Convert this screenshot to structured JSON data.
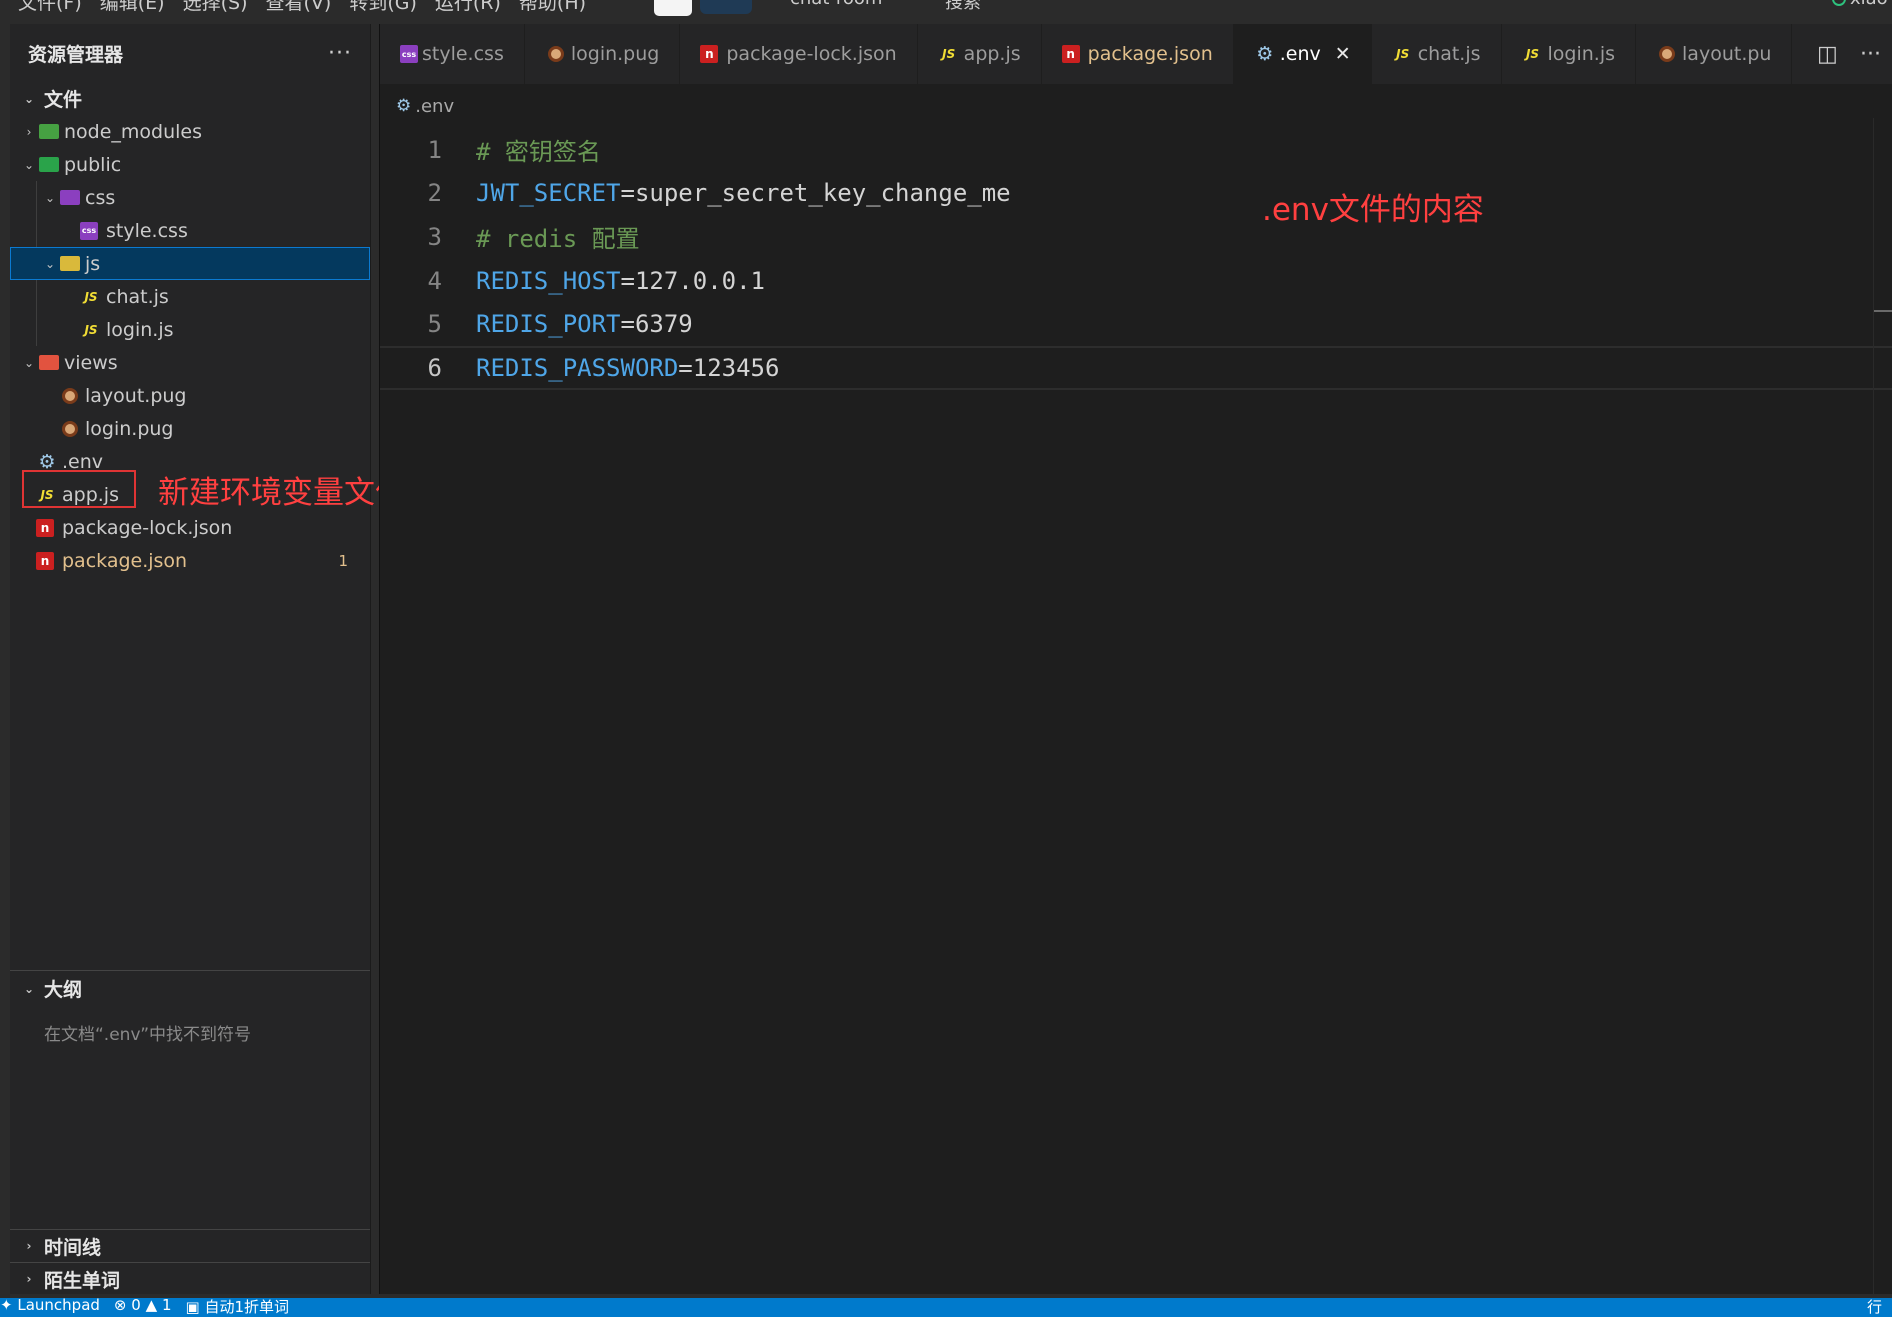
{
  "titlebar": {
    "menus": [
      "文件(F)",
      "编辑(E)",
      "选择(S)",
      "查看(V)",
      "转到(G)",
      "运行(R)",
      "帮助(H)"
    ],
    "search_text": "chat-room",
    "search_label": "搜索",
    "account": "xiao"
  },
  "explorer": {
    "title": "资源管理器",
    "more": "···",
    "root_section": "文件",
    "items": [
      {
        "label": "node_modules",
        "icon": "folder-node-icon"
      },
      {
        "label": "public",
        "icon": "folder-public-icon"
      },
      {
        "label": "css",
        "icon": "folder-css-icon"
      },
      {
        "label": "style.css",
        "icon": "css-file-icon"
      },
      {
        "label": "js",
        "icon": "folder-js-icon"
      },
      {
        "label": "chat.js",
        "icon": "js-file-icon"
      },
      {
        "label": "login.js",
        "icon": "js-file-icon"
      },
      {
        "label": "views",
        "icon": "folder-views-icon"
      },
      {
        "label": "layout.pug",
        "icon": "pug-file-icon"
      },
      {
        "label": "login.pug",
        "icon": "pug-file-icon"
      },
      {
        "label": ".env",
        "icon": "gear-icon"
      },
      {
        "label": "app.js",
        "icon": "js-file-icon"
      },
      {
        "label": "package-lock.json",
        "icon": "npm-file-icon"
      },
      {
        "label": "package.json",
        "icon": "npm-file-icon",
        "badge": "1"
      }
    ],
    "annotation_new_file": "新建环境变量文件"
  },
  "outline": {
    "title": "大纲",
    "empty_message": "在文档“.env”中找不到符号"
  },
  "timeline": {
    "title": "时间线"
  },
  "vocab": {
    "title": "陌生单词"
  },
  "editor": {
    "tabs": [
      {
        "label": "style.css",
        "icon": "css-file-icon"
      },
      {
        "label": "login.pug",
        "icon": "pug-file-icon"
      },
      {
        "label": "package-lock.json",
        "icon": "npm-file-icon"
      },
      {
        "label": "app.js",
        "icon": "js-file-icon"
      },
      {
        "label": "package.json",
        "icon": "npm-file-icon"
      },
      {
        "label": ".env",
        "icon": "gear-icon",
        "active": true
      },
      {
        "label": "chat.js",
        "icon": "js-file-icon"
      },
      {
        "label": "login.js",
        "icon": "js-file-icon"
      },
      {
        "label": "layout.pu",
        "icon": "pug-file-icon"
      }
    ],
    "breadcrumb": ".env",
    "lines": [
      {
        "num": "1",
        "comment": "# 密钥签名"
      },
      {
        "num": "2",
        "key": "JWT_SECRET",
        "value": "=super_secret_key_change_me"
      },
      {
        "num": "3",
        "comment": "# redis 配置"
      },
      {
        "num": "4",
        "key": "REDIS_HOST",
        "value": "=127.0.0.1"
      },
      {
        "num": "5",
        "key": "REDIS_PORT",
        "value": "=6379"
      },
      {
        "num": "6",
        "key": "REDIS_PASSWORD",
        "value": "=123456"
      }
    ],
    "annotation_content": ".env文件的内容"
  },
  "statusbar": {
    "launchpad": "Launchpad",
    "errors": "0",
    "warnings": "1",
    "auto_translate": "自动1折单词",
    "position": "行"
  },
  "colors": {
    "accent": "#007acc",
    "annotation": "#ff4040",
    "key": "#4fa6e8",
    "comment": "#6a9955",
    "modified": "#e2c08d"
  }
}
